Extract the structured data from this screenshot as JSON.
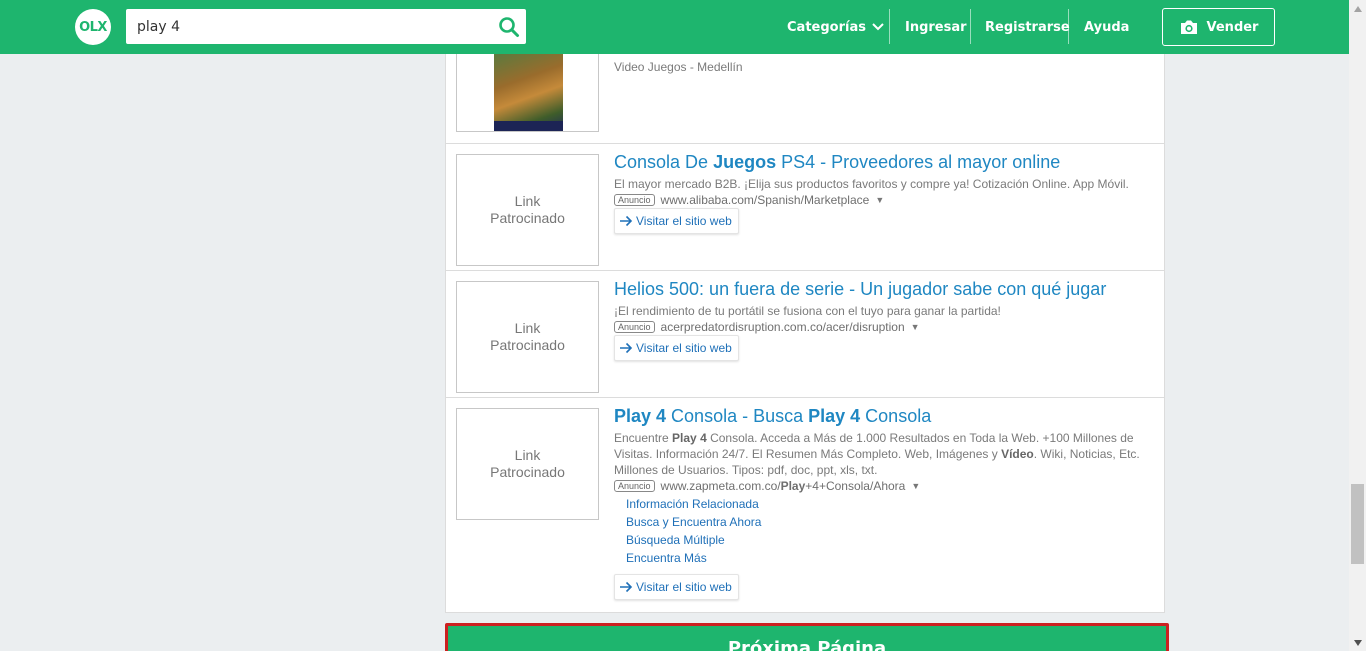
{
  "header": {
    "logo_text": "OLX",
    "search_value": "play 4",
    "nav": {
      "categories": "Categorías",
      "login": "Ingresar",
      "register": "Registrarse",
      "help": "Ayuda",
      "sell": "Vender"
    }
  },
  "results": {
    "top_item": {
      "location": "Video Juegos - Medellín"
    },
    "ads": [
      {
        "thumb_line1": "Link",
        "thumb_line2": "Patrocinado",
        "title_a": "Consola De ",
        "title_b": "Juegos",
        "title_c": " PS4 - Proveedores al mayor online",
        "desc": "El mayor mercado B2B. ¡Elija sus productos favoritos y compre ya! Cotización Online. App Móvil.",
        "badge": "Anuncio",
        "url": "www.alibaba.com/Spanish/Marketplace",
        "visit": "Visitar el sitio web"
      },
      {
        "thumb_line1": "Link",
        "thumb_line2": "Patrocinado",
        "title": "Helios 500: un fuera de serie - Un jugador sabe con qué jugar",
        "desc": "¡El rendimiento de tu portátil se fusiona con el tuyo para ganar la partida!",
        "badge": "Anuncio",
        "url": "acerpredatordisruption.com.co/acer/disruption",
        "visit": "Visitar el sitio web"
      },
      {
        "thumb_line1": "Link",
        "thumb_line2": "Patrocinado",
        "title_a": "Play 4",
        "title_b": " Consola - Busca ",
        "title_c": "Play 4",
        "title_d": " Consola",
        "desc_a": "Encuentre ",
        "desc_b": "Play 4",
        "desc_c": " Consola. Acceda a Más de 1.000 Resultados en Toda la Web. +100 Millones de Visitas. Información 24/7. El Resumen Más Completo. Web, Imágenes y ",
        "desc_d": "Vídeo",
        "desc_e": ". Wiki, Noticias, Etc. Millones de Usuarios. Tipos: pdf, doc, ppt, xls, txt.",
        "badge": "Anuncio",
        "url_a": "www.zapmeta.com.co/",
        "url_b": "Play",
        "url_c": "+4+Consola/Ahora",
        "sublinks": [
          "Información Relacionada",
          "Busca y Encuentra Ahora",
          "Búsqueda Múltiple",
          "Encuentra Más"
        ],
        "visit": "Visitar el sitio web"
      }
    ]
  },
  "next_page": "Próxima Página",
  "colors": {
    "brand_green": "#1eb56e",
    "link_blue": "#1f87c2",
    "outline_red": "#cc2020"
  }
}
